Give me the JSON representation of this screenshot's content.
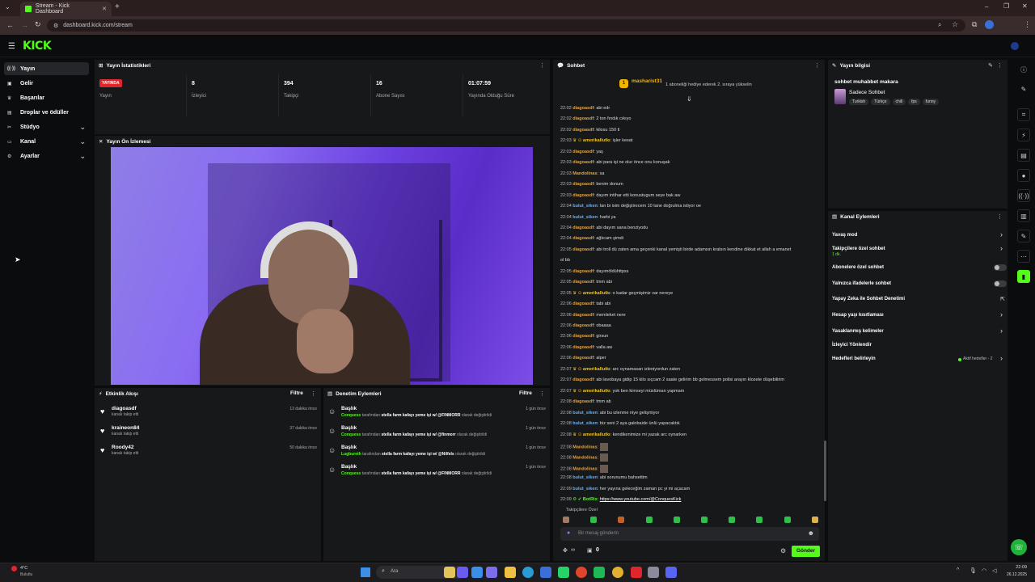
{
  "browser": {
    "tab_title": "Stream - Kick Dashboard",
    "url": "dashboard.kick.com/stream"
  },
  "logo": "KICK",
  "sidebar": [
    {
      "label": "Yayın",
      "icon": "broadcast-icon",
      "active": true
    },
    {
      "label": "Gelir",
      "icon": "wallet-icon"
    },
    {
      "label": "Başarılar",
      "icon": "trophy-icon"
    },
    {
      "label": "Droplar ve ödüller",
      "icon": "gift-icon"
    },
    {
      "label": "Stüdyo",
      "icon": "studio-icon",
      "expand": true
    },
    {
      "label": "Kanal",
      "icon": "channel-icon",
      "expand": true
    },
    {
      "label": "Ayarlar",
      "icon": "gear-icon",
      "expand": true
    }
  ],
  "stats": {
    "title": "Yayın İstatistikleri",
    "live_badge": "YAYINDA",
    "live_label": "Yayın",
    "items": [
      {
        "value": "8",
        "label": "İzleyici"
      },
      {
        "value": "394",
        "label": "Takipçi"
      },
      {
        "value": "16",
        "label": "Abone Sayısı"
      },
      {
        "value": "01:07:59",
        "label": "Yayında Olduğu Süre"
      }
    ]
  },
  "preview": {
    "title": "Yayın Ön İzlemesi"
  },
  "activity": {
    "title": "Etkinlik Akışı",
    "filter": "Filtre",
    "items": [
      {
        "user": "diagoasdf",
        "text": "kanalı takip etti",
        "time": "13 dakika önce"
      },
      {
        "user": "kraineon84",
        "text": "kanalı takip etti",
        "time": "37 dakika önce"
      },
      {
        "user": "Roody42",
        "text": "kanalı takip etti",
        "time": "50 dakika önce"
      }
    ]
  },
  "moderation": {
    "title": "Denetim Eylemleri",
    "filter": "Filtre",
    "items": [
      {
        "head": "Başlık",
        "actor": "Conquess",
        "mid": "tarafından",
        "value": "stella farm kafayı yeme işi w/ @FINMORR",
        "tail": "olarak değiştirildi",
        "time": "1 gün önce"
      },
      {
        "head": "Başlık",
        "actor": "Conquess",
        "mid": "tarafından",
        "value": "stella farm kafayı yeme işi w/ @finmorr",
        "tail": "olarak değiştirildi",
        "time": "1 gün önce"
      },
      {
        "head": "Başlık",
        "actor": "Lugbureth",
        "mid": "tarafından",
        "value": "stella farm kafayı yeme işi w/ @Nilfels",
        "tail": "olarak değiştirildi",
        "time": "1 gün önce"
      },
      {
        "head": "Başlık",
        "actor": "Conquess",
        "mid": "tarafından",
        "value": "stella farm kafayı yeme işi w/ @FINMORR",
        "tail": "olarak değiştirildi",
        "time": "1 gün önce"
      }
    ]
  },
  "chat": {
    "title": "Sohbet",
    "pinned_user": "masharist31",
    "pinned_count": "1",
    "pinned_text": "1 aboneliği hediye ederek 2. sıraya yükselin",
    "messages": [
      {
        "t": "22:02",
        "u": "diagoasdf",
        "c": "#e6a23c",
        "m": "abi edr"
      },
      {
        "t": "22:02",
        "u": "diagoasdf",
        "c": "#e6a23c",
        "m": "2 ton fındık cıkıyo"
      },
      {
        "t": "22:02",
        "u": "diagoasdf",
        "c": "#e6a23c",
        "m": "kilosu 150 tl"
      },
      {
        "t": "22:03",
        "u": "amerikallutkı",
        "c": "#f0c419",
        "m": "işler kesat"
      },
      {
        "t": "22:03",
        "u": "diagoasdf",
        "c": "#e6a23c",
        "m": "yaş"
      },
      {
        "t": "22:03",
        "u": "diagoasdf",
        "c": "#e6a23c",
        "m": "abi para işi ne olur önce onu konuşak"
      },
      {
        "t": "22:03",
        "u": "Mandolinas",
        "c": "#e6a23c",
        "m": "sa"
      },
      {
        "t": "22:03",
        "u": "diagoasdf",
        "c": "#e6a23c",
        "m": "benim donum"
      },
      {
        "t": "22:03",
        "u": "diagoasdf",
        "c": "#e6a23c",
        "m": "dayım intihar etti konustugum seye bak aw"
      },
      {
        "t": "22:04",
        "u": "bulut_siken",
        "c": "#6ab0f3",
        "m": "lan bi isim değiştirecem 10 tane doğrulma istiyor oe"
      },
      {
        "t": "22:04",
        "u": "bulut_siken",
        "c": "#6ab0f3",
        "m": "harbi ya"
      },
      {
        "t": "22:04",
        "u": "diagoasdf",
        "c": "#e6a23c",
        "m": "abi dayım sana benziyodu"
      },
      {
        "t": "22:04",
        "u": "diagoasdf",
        "c": "#e6a23c",
        "m": "ağlıcam şimdi"
      },
      {
        "t": "22:05",
        "u": "diagoasdf",
        "c": "#e6a23c",
        "m": "abi troll dü zaten ama geçenki kanal yemişti birde adamsın kralsın kendine dikkat et allah a emanet"
      },
      {
        "t": "",
        "u": "",
        "c": "#ddd",
        "m": "ol bb"
      },
      {
        "t": "22:05",
        "u": "diagoasdf",
        "c": "#e6a23c",
        "m": "dayımöldühttpss"
      },
      {
        "t": "22:05",
        "u": "diagoasdf",
        "c": "#e6a23c",
        "m": "tmm abi"
      },
      {
        "t": "22:05",
        "u": "amerikallutkı",
        "c": "#f0c419",
        "m": "o kadar geçmişimiz var nereye"
      },
      {
        "t": "22:06",
        "u": "diagoasdf",
        "c": "#e6a23c",
        "m": "tabi abi"
      },
      {
        "t": "22:06",
        "u": "diagoasdf",
        "c": "#e6a23c",
        "m": "memleket nere"
      },
      {
        "t": "22:06",
        "u": "diagoasdf",
        "c": "#e6a23c",
        "m": "obaaaa"
      },
      {
        "t": "22:06",
        "u": "diagoasdf",
        "c": "#e6a23c",
        "m": "girsun"
      },
      {
        "t": "22:06",
        "u": "diagoasdf",
        "c": "#e6a23c",
        "m": "valla aw"
      },
      {
        "t": "22:06",
        "u": "diagoasdf",
        "c": "#e6a23c",
        "m": "alper"
      },
      {
        "t": "22:07",
        "u": "amerikallutkı",
        "c": "#f0c419",
        "m": "arc oynamasan izleniyordun zaten"
      },
      {
        "t": "22:07",
        "u": "diagoasdf",
        "c": "#e6a23c",
        "m": "abi lavobaya gidip 15 kilo sıçcam 2 saate gelirim bb gelmessem polisi arayın klozete düşebilirim"
      },
      {
        "t": "22:07",
        "u": "amerikallutkı",
        "c": "#f0c419",
        "m": "yok ben kimseyi müslüman yapmam"
      },
      {
        "t": "22:08",
        "u": "diagoasdf",
        "c": "#e6a23c",
        "m": "tmm ab"
      },
      {
        "t": "22:08",
        "u": "bulut_siken",
        "c": "#6ab0f3",
        "m": "abi bu izlenme niye gelişmiyor"
      },
      {
        "t": "22:08",
        "u": "bulut_siken",
        "c": "#6ab0f3",
        "m": "biz seni 2 aya galobaide ünlü yapacaktık"
      },
      {
        "t": "22:08",
        "u": "amerikallutkı",
        "c": "#f0c419",
        "m": "kendikenimize mi yazak arc oynarken"
      },
      {
        "t": "22:08",
        "u": "Mandolinas",
        "c": "#e6a23c",
        "m": ""
      },
      {
        "t": "22:08",
        "u": "Mandolinas",
        "c": "#e6a23c",
        "m": ""
      },
      {
        "t": "22:08",
        "u": "Mandolinas",
        "c": "#e6a23c",
        "m": ""
      },
      {
        "t": "22:08",
        "u": "bulut_siken",
        "c": "#6ab0f3",
        "m": "abi sorunumu bahsettim"
      },
      {
        "t": "22:09",
        "u": "bulut_siken",
        "c": "#6ab0f3",
        "m": "her yayına geleceğim zaman pc yi mi açacam"
      },
      {
        "t": "22:09",
        "u": "BotRix",
        "c": "#53fc18",
        "m": "https://www.youtube.com/@ConquesKick"
      }
    ],
    "followers_only": "Takipçilere Özel",
    "placeholder": "Bir mesaj gönderin",
    "infinity": "∞",
    "count": "0",
    "send": "Gönder"
  },
  "info": {
    "title": "Yayın bilgisi",
    "stream_title": "sohbet muhabbet makara",
    "category": "Sadece Sohbet",
    "tags": [
      "Turkish",
      "Türkçe",
      "chill",
      "fps",
      "funny"
    ]
  },
  "actions": {
    "title": "Kanal Eylemleri",
    "items": [
      {
        "label": "Yavaş mod",
        "ctrl": "arrow"
      },
      {
        "label": "Takipçilere özel sohbet",
        "sub": "1 dk.",
        "ctrl": "arrow"
      },
      {
        "label": "Abonelere özel sohbet",
        "ctrl": "toggle"
      },
      {
        "label": "Yalnızca ifadelerle sohbet",
        "ctrl": "toggle"
      },
      {
        "label": "Yapay Zeka ile Sohbet Denetimi",
        "ctrl": "ext"
      },
      {
        "label": "Hesap yaşı kısıtlaması",
        "ctrl": "arrow"
      },
      {
        "label": "Yasaklanmış kelimeler",
        "ctrl": "arrow"
      },
      {
        "label": "İzleyici Yönlendir",
        "ctrl": "none"
      },
      {
        "label": "Hedefleri belirleyin",
        "ctrl": "arrow",
        "badge": "Aktif hedefler - 2"
      }
    ]
  },
  "taskbar": {
    "weather_temp": "4°C",
    "weather_text": "Bulutlu",
    "search": "Ara",
    "time": "22:09",
    "date": "26.12.2025"
  },
  "colors": {
    "accent": "#53fc18",
    "panel": "#17181a",
    "bg": "#0b0c0d",
    "live": "#e0262b"
  }
}
